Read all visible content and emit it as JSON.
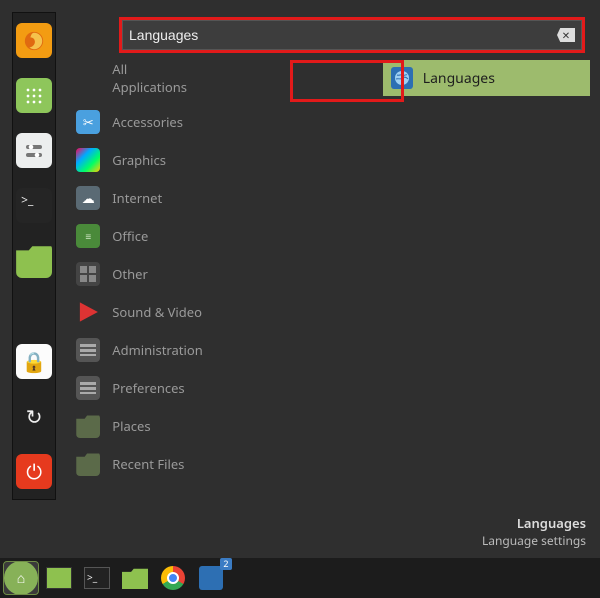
{
  "search": {
    "value": "Languages"
  },
  "favorites": [
    {
      "name": "firefox",
      "glyph": ""
    },
    {
      "name": "app-grid",
      "glyph": ""
    },
    {
      "name": "settings",
      "glyph": ""
    },
    {
      "name": "terminal",
      "glyph": ">_"
    },
    {
      "name": "files",
      "glyph": ""
    },
    {
      "name": "lock",
      "glyph": "🔒"
    },
    {
      "name": "logout",
      "glyph": "↻"
    },
    {
      "name": "shutdown",
      "glyph": "⏻"
    }
  ],
  "categories": [
    {
      "key": "all",
      "label": "All Applications",
      "show_icon": false
    },
    {
      "key": "accessories",
      "label": "Accessories"
    },
    {
      "key": "graphics",
      "label": "Graphics"
    },
    {
      "key": "internet",
      "label": "Internet"
    },
    {
      "key": "office",
      "label": "Office"
    },
    {
      "key": "other",
      "label": "Other"
    },
    {
      "key": "sound",
      "label": "Sound & Video"
    },
    {
      "key": "admin",
      "label": "Administration"
    },
    {
      "key": "prefs",
      "label": "Preferences"
    },
    {
      "key": "places",
      "label": "Places"
    },
    {
      "key": "recent",
      "label": "Recent Files"
    }
  ],
  "results": [
    {
      "label": "Languages",
      "icon": "globe"
    }
  ],
  "description": {
    "title": "Languages",
    "subtitle": "Language settings"
  },
  "taskbar": {
    "badge_count": "2"
  }
}
